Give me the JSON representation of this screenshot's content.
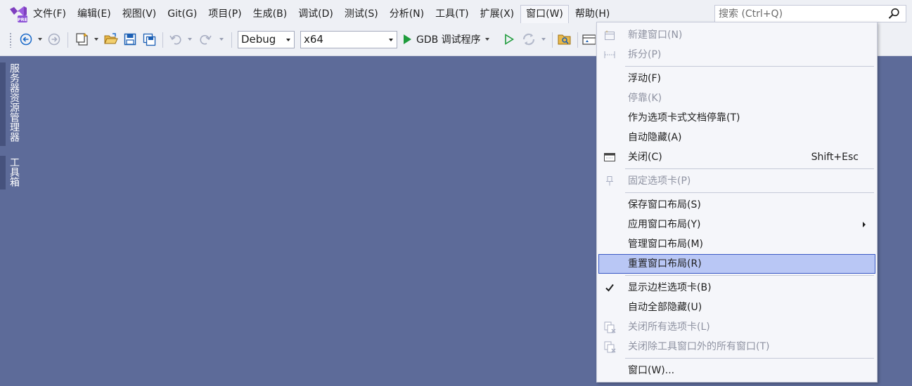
{
  "menubar": {
    "items": [
      {
        "label": "文件(F)"
      },
      {
        "label": "编辑(E)"
      },
      {
        "label": "视图(V)"
      },
      {
        "label": "Git(G)"
      },
      {
        "label": "项目(P)"
      },
      {
        "label": "生成(B)"
      },
      {
        "label": "调试(D)"
      },
      {
        "label": "测试(S)"
      },
      {
        "label": "分析(N)"
      },
      {
        "label": "工具(T)"
      },
      {
        "label": "扩展(X)"
      },
      {
        "label": "窗口(W)",
        "active": true
      },
      {
        "label": "帮助(H)"
      }
    ],
    "search_placeholder": "搜索 (Ctrl+Q)",
    "logo_badge": "PRE"
  },
  "toolbar": {
    "configuration": "Debug",
    "platform": "x64",
    "debugger_label": "GDB 调试程序",
    "icons": [
      "back-icon",
      "forward-icon",
      "new-project-icon",
      "open-folder-icon",
      "save-icon",
      "save-all-icon",
      "undo-icon",
      "redo-icon",
      "start-debug-icon",
      "start-without-debug-icon",
      "hot-reload-icon",
      "solution-explorer-icon",
      "toolbox-icon"
    ]
  },
  "side_tabs": {
    "server_explorer": "服务器资源管理器",
    "toolbox": "工具箱"
  },
  "window_menu": {
    "items": [
      {
        "label": "新建窗口(N)",
        "disabled": true,
        "icon": "new-window-icon"
      },
      {
        "label": "拆分(P)",
        "disabled": true,
        "icon": "split-icon"
      },
      {
        "label": "浮动(F)"
      },
      {
        "label": "停靠(K)",
        "disabled": true
      },
      {
        "label": "作为选项卡式文档停靠(T)"
      },
      {
        "label": "自动隐藏(A)"
      },
      {
        "label": "关闭(C)",
        "shortcut": "Shift+Esc",
        "icon": "close-window-icon"
      },
      {
        "label": "固定选项卡(P)",
        "disabled": true,
        "icon": "pin-icon"
      },
      {
        "label": "保存窗口布局(S)"
      },
      {
        "label": "应用窗口布局(Y)",
        "submenu": true
      },
      {
        "label": "管理窗口布局(M)"
      },
      {
        "label": "重置窗口布局(R)",
        "highlighted": true
      },
      {
        "label": "显示边栏选项卡(B)",
        "checked": true,
        "icon": "check-icon"
      },
      {
        "label": "自动全部隐藏(U)"
      },
      {
        "label": "关闭所有选项卡(L)",
        "disabled": true,
        "icon": "close-all-tabs-icon"
      },
      {
        "label": "关闭除工具窗口外的所有窗口(T)",
        "disabled": true,
        "icon": "close-all-but-tool-icon"
      },
      {
        "label": "窗口(W)..."
      }
    ]
  },
  "colors": {
    "workspace": "#5d6b99",
    "chrome": "#eef0f5",
    "menu_bg": "#f5f6fa",
    "highlight_bg": "#b9c7f5",
    "highlight_border": "#3a59c4",
    "vs_purple": "#68217a",
    "play_green": "#1f9c3c"
  }
}
